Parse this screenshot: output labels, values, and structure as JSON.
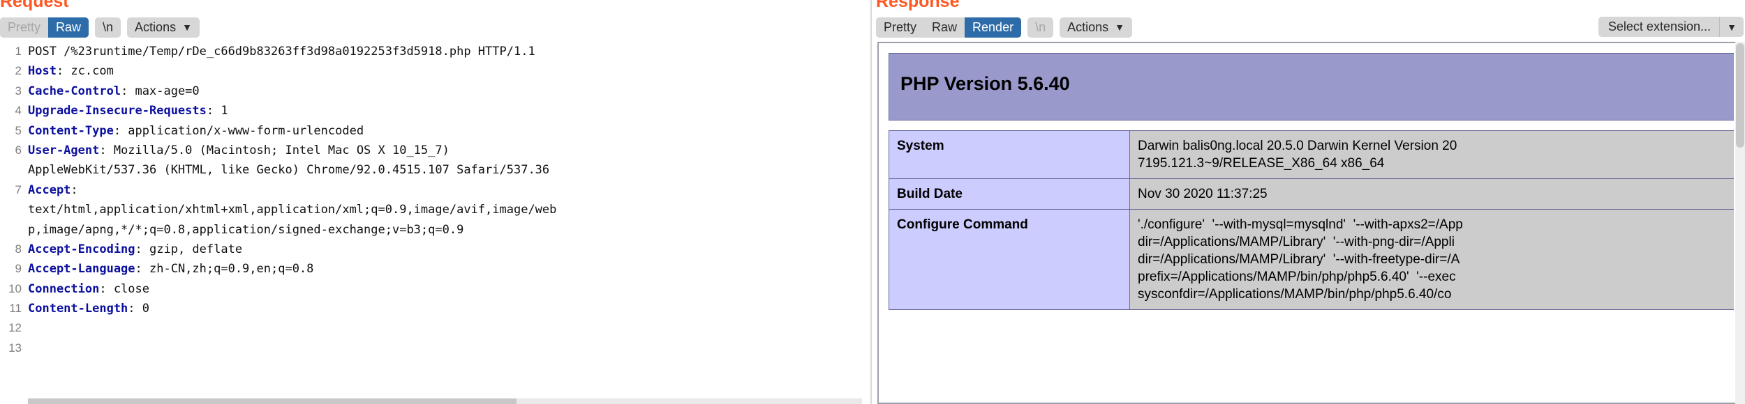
{
  "request": {
    "title": "Request",
    "tabs": [
      {
        "label": "Pretty",
        "selected": false,
        "disabled": true
      },
      {
        "label": "Raw",
        "selected": true,
        "disabled": false
      }
    ],
    "newline_button": "\\n",
    "actions_button": "Actions",
    "caret_icon": "chevron-down-icon",
    "lines": [
      {
        "num": "1",
        "name": "",
        "value": "POST /%23runtime/Temp/rDe_c66d9b83263ff3d98a0192253f3d5918.php HTTP/1.1"
      },
      {
        "num": "2",
        "name": "Host",
        "value": ": zc.com"
      },
      {
        "num": "3",
        "name": "Cache-Control",
        "value": ": max-age=0"
      },
      {
        "num": "4",
        "name": "Upgrade-Insecure-Requests",
        "value": ": 1"
      },
      {
        "num": "5",
        "name": "Content-Type",
        "value": ": application/x-www-form-urlencoded"
      },
      {
        "num": "6",
        "name": "User-Agent",
        "value": ": Mozilla/5.0 (Macintosh; Intel Mac OS X 10_15_7)"
      },
      {
        "num": "",
        "name": "",
        "value": "AppleWebKit/537.36 (KHTML, like Gecko) Chrome/92.0.4515.107 Safari/537.36"
      },
      {
        "num": "7",
        "name": "Accept",
        "value": ":"
      },
      {
        "num": "",
        "name": "",
        "value": "text/html,application/xhtml+xml,application/xml;q=0.9,image/avif,image/web"
      },
      {
        "num": "",
        "name": "",
        "value": "p,image/apng,*/*;q=0.8,application/signed-exchange;v=b3;q=0.9"
      },
      {
        "num": "8",
        "name": "Accept-Encoding",
        "value": ": gzip, deflate"
      },
      {
        "num": "9",
        "name": "Accept-Language",
        "value": ": zh-CN,zh;q=0.9,en;q=0.8"
      },
      {
        "num": "10",
        "name": "Connection",
        "value": ": close"
      },
      {
        "num": "11",
        "name": "Content-Length",
        "value": ": 0"
      },
      {
        "num": "12",
        "name": "",
        "value": ""
      },
      {
        "num": "13",
        "name": "",
        "value": ""
      }
    ]
  },
  "response": {
    "title": "Response",
    "tabs": [
      {
        "label": "Pretty",
        "selected": false,
        "disabled": false
      },
      {
        "label": "Raw",
        "selected": false,
        "disabled": false
      },
      {
        "label": "Render",
        "selected": true,
        "disabled": false
      }
    ],
    "newline_button": "\\n",
    "actions_button": "Actions",
    "caret_icon": "chevron-down-icon",
    "extension_select": {
      "value": "Select extension...",
      "arrow_icon": "chevron-down-icon"
    },
    "render": {
      "php_version_heading": "PHP Version 5.6.40",
      "rows": [
        {
          "key": "System",
          "value": "Darwin balis0ng.local 20.5.0 Darwin Kernel Version 20\n7195.121.3~9/RELEASE_X86_64 x86_64"
        },
        {
          "key": "Build Date",
          "value": "Nov 30 2020 11:37:25"
        },
        {
          "key": "Configure Command",
          "value": "'./configure'  '--with-mysql=mysqlnd'  '--with-apxs2=/App\ndir=/Applications/MAMP/Library'  '--with-png-dir=/Appli\ndir=/Applications/MAMP/Library'  '--with-freetype-dir=/A\nprefix=/Applications/MAMP/bin/php/php5.6.40'  '--exec\nsysconfdir=/Applications/MAMP/bin/php/php5.6.40/co"
        }
      ]
    }
  },
  "colors": {
    "accent_orange": "#ff5722",
    "selected_blue": "#2d6ca8",
    "php_banner_purple": "#9999cc",
    "table_key_purple": "#ccccff",
    "table_value_gray": "#cccccc",
    "header_name_blue": "#0b0f9e"
  }
}
